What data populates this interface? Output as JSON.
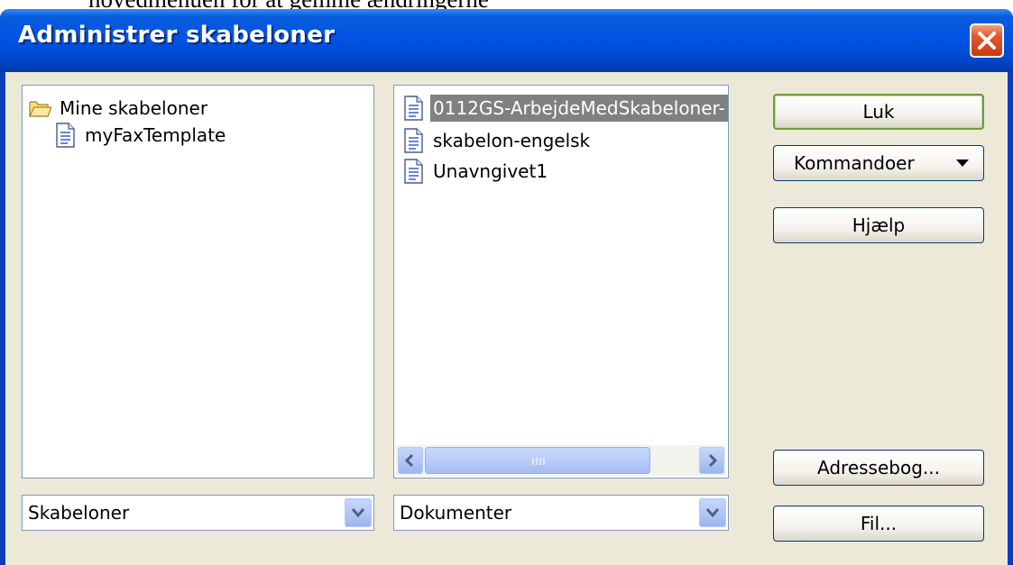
{
  "background_text": "hovedmenuen for at gemme ændringerne",
  "window": {
    "title": "Administrer skabeloner",
    "close_glyph": "✕"
  },
  "left_panel": {
    "items": [
      {
        "label": "Mine skabeloner",
        "icon": "folder-open-icon"
      },
      {
        "label": "myFaxTemplate",
        "icon": "document-icon"
      }
    ]
  },
  "middle_panel": {
    "items": [
      {
        "label": "0112GS-ArbejdeMedSkabeloner-",
        "icon": "document-icon",
        "selected": true
      },
      {
        "label": "skabelon-engelsk",
        "icon": "document-icon"
      },
      {
        "label": "Unavngivet1",
        "icon": "document-icon"
      }
    ]
  },
  "combos": {
    "left": {
      "value": "Skabeloner"
    },
    "middle": {
      "value": "Dokumenter"
    }
  },
  "buttons": {
    "close": "Luk",
    "commands": "Kommandoer",
    "help": "Hjælp",
    "address_book": "Adressebog...",
    "file": "Fil..."
  },
  "colors": {
    "title_bar": "#0054e3",
    "dialog_bg": "#ece9d8",
    "default_button_border": "#6f9b3a",
    "close_button": "#e05a30",
    "selection": "#808080"
  }
}
